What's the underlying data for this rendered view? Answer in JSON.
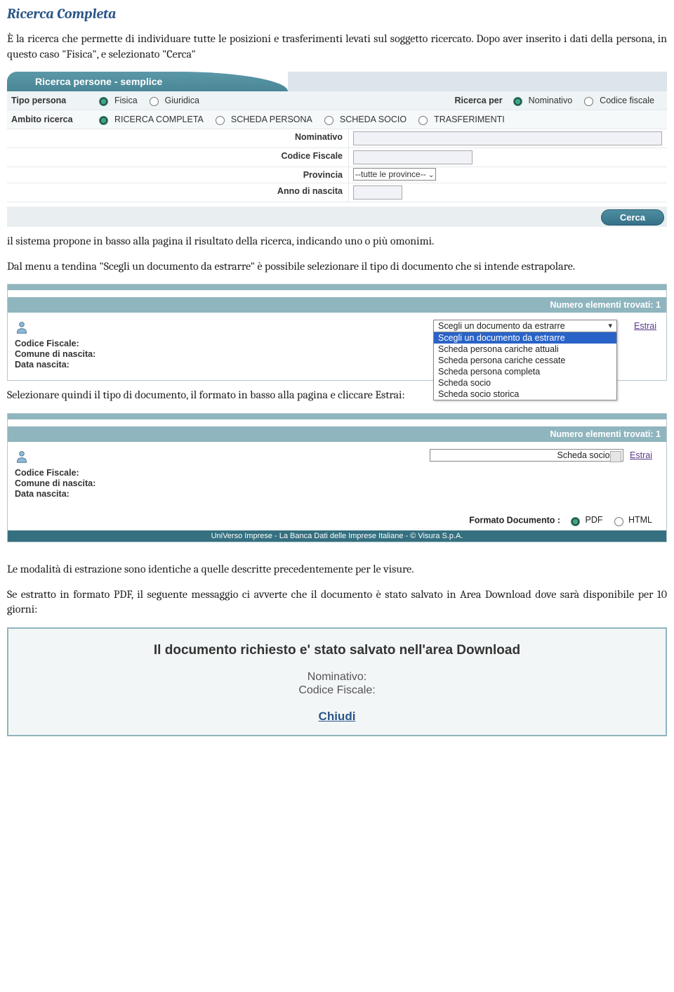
{
  "doc": {
    "title": "Ricerca Completa",
    "p1": "È la ricerca che permette di individuare tutte le posizioni e trasferimenti levati sul soggetto ricercato. Dopo aver inserito i dati della persona, in questo caso \"Fisica\", e selezionato \"Cerca\"",
    "p2": "il sistema propone in basso alla pagina il risultato della ricerca, indicando uno o più omonimi.",
    "p3": "Dal menu a tendina \"Scegli un documento da estrarre\" è possibile selezionare il tipo di documento che si intende estrapolare.",
    "p4": "Selezionare quindi il tipo di documento, il formato in basso alla pagina e cliccare Estrai:",
    "p5": "Le modalità di estrazione sono identiche a quelle descritte precedentemente per le visure.",
    "p6": "Se estratto in formato PDF, il seguente messaggio ci avverte che il documento è stato salvato in Area Download dove sarà disponibile per 10 giorni:"
  },
  "form": {
    "tab_title": "Ricerca persone - semplice",
    "tipo_label": "Tipo persona",
    "tipo_opts": {
      "fisica": "Fisica",
      "giuridica": "Giuridica"
    },
    "ricerca_per_label": "Ricerca per",
    "ricerca_per_opts": {
      "nominativo": "Nominativo",
      "cf": "Codice fiscale"
    },
    "ambito_label": "Ambito ricerca",
    "ambito_opts": {
      "completa": "RICERCA COMPLETA",
      "scheda": "SCHEDA PERSONA",
      "socio": "SCHEDA SOCIO",
      "trasf": "TRASFERIMENTI"
    },
    "fields": {
      "nominativo": "Nominativo",
      "cf": "Codice Fiscale",
      "provincia": "Provincia",
      "anno": "Anno di nascita"
    },
    "provincia_value": "--tutte le province--",
    "cerca": "Cerca"
  },
  "results": {
    "header": "Numero elementi trovati: 1",
    "labels": {
      "cf": "Codice Fiscale:",
      "comune": "Comune di nascita:",
      "data": "Data nascita:"
    },
    "estrai": "Estrai",
    "dropdown_top": "Scegli un documento da estrarre",
    "options": [
      "Scegli un documento da estrarre",
      "Scheda persona cariche attuali",
      "Scheda persona cariche cessate",
      "Scheda persona completa",
      "Scheda socio",
      "Scheda socio storica"
    ]
  },
  "results2": {
    "selected": "Scheda socio",
    "formato_label": "Formato Documento :",
    "fmt_pdf": "PDF",
    "fmt_html": "HTML",
    "footer": "UniVerso Imprese - La Banca Dati delle Imprese Italiane - © Visura S.p.A."
  },
  "download": {
    "title": "Il documento richiesto e' stato salvato nell'area Download",
    "l1": "Nominativo:",
    "l2": "Codice Fiscale:",
    "close": "Chiudi"
  }
}
